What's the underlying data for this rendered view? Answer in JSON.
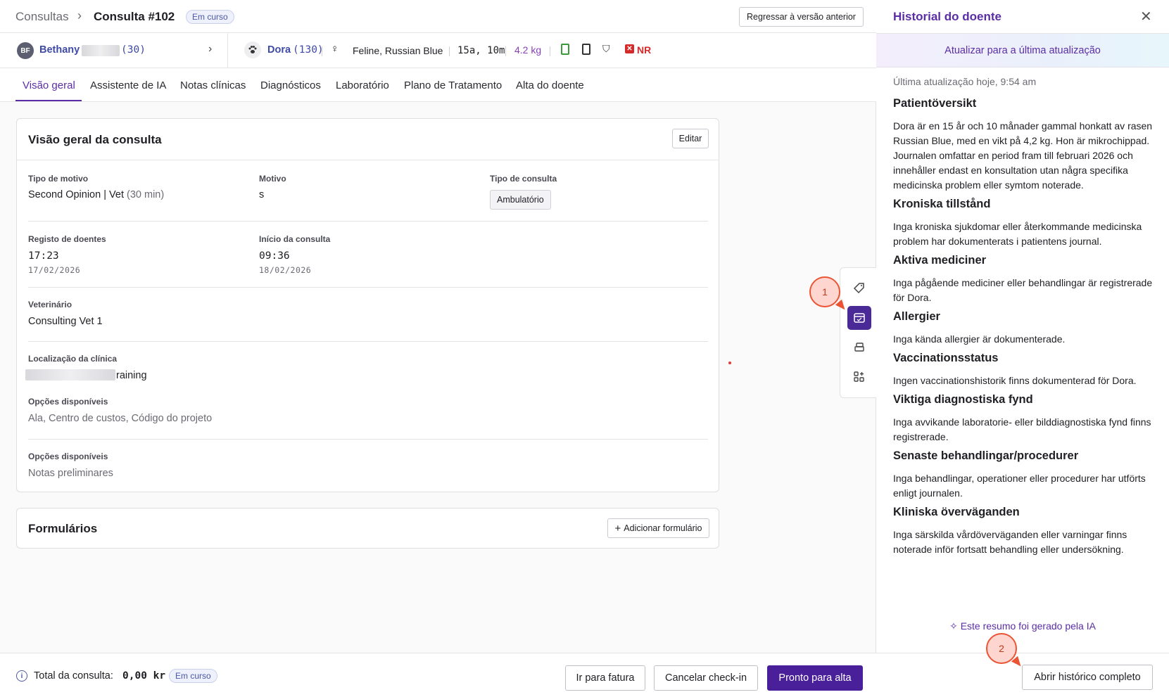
{
  "breadcrumb": {
    "root": "Consultas",
    "separator": "›",
    "current": "Consulta #102"
  },
  "status": "Em curso",
  "revert_button": "Regressar à versão anterior",
  "owner": {
    "initials": "BF",
    "name": "Bethany",
    "count": "(30)"
  },
  "pet": {
    "name": "Dora",
    "count": "(130)",
    "sex_symbol": "♀",
    "breed": "Feline, Russian Blue",
    "age": "15a, 10m",
    "weight": "4.2 kg",
    "flag_letter": "✕",
    "flag": "NR"
  },
  "tabs": [
    "Visão geral",
    "Assistente de IA",
    "Notas clínicas",
    "Diagnósticos",
    "Laboratório",
    "Plano de Tratamento",
    "Alta do doente"
  ],
  "overview": {
    "title": "Visão geral da consulta",
    "edit": "Editar",
    "reason_type_label": "Tipo de motivo",
    "reason_type_value": "Second Opinion | Vet",
    "reason_type_duration": "(30 min)",
    "reason_label": "Motivo",
    "reason_value": "s",
    "consult_type_label": "Tipo de consulta",
    "consult_type_value": "Ambulatório",
    "registry_label": "Registo de doentes",
    "registry_time": "17:23",
    "registry_date": "17/02/2026",
    "start_label": "Início da consulta",
    "start_time": "09:36",
    "start_date": "18/02/2026",
    "vet_label": "Veterinário",
    "vet_value": "Consulting Vet 1",
    "location_label": "Localização da clínica",
    "location_value": "raining",
    "options_label": "Opções disponíveis",
    "options_value": "Ala, Centro de custos, Código do projeto",
    "options2_label": "Opções disponíveis",
    "options2_value": "Notas preliminares"
  },
  "forms": {
    "title": "Formulários",
    "add": "Adicionar formulário"
  },
  "callouts": [
    "1",
    "2"
  ],
  "footer": {
    "info_glyph": "i",
    "total_label": "Total da consulta:",
    "total_value": "0,00 kr",
    "invoice": "Ir para fatura",
    "cancel": "Cancelar check-in",
    "ready": "Pronto para alta"
  },
  "history": {
    "title": "Historial do doente",
    "close": "✕",
    "update_banner": "Atualizar para a última atualização",
    "last_updated": "Última atualização hoje, 9:54 am",
    "sections": [
      {
        "heading": "Patientöversikt",
        "text": "Dora är en 15 år och 10 månader gammal honkatt av rasen Russian Blue, med en vikt på 4,2 kg. Hon är mikrochippad. Journalen omfattar en period fram till februari 2026 och innehåller endast en konsultation utan några specifika medicinska problem eller symtom noterade."
      },
      {
        "heading": "Kroniska tillstånd",
        "text": "Inga kroniska sjukdomar eller återkommande medicinska problem har dokumenterats i patientens journal."
      },
      {
        "heading": "Aktiva mediciner",
        "text": "Inga pågående mediciner eller behandlingar är registrerade för Dora."
      },
      {
        "heading": "Allergier",
        "text": "Inga kända allergier är dokumenterade."
      },
      {
        "heading": "Vaccinationsstatus",
        "text": "Ingen vaccinationshistorik finns dokumenterad för Dora."
      },
      {
        "heading": "Viktiga diagnostiska fynd",
        "text": "Inga avvikande laboratorie- eller bilddiagnostiska fynd finns registrerade."
      },
      {
        "heading": "Senaste behandlingar/procedurer",
        "text": "Inga behandlingar, operationer eller procedurer har utförts enligt journalen."
      },
      {
        "heading": "Kliniska överväganden",
        "text": "Inga särskilda vårdöverväganden eller varningar finns noterade inför fortsatt behandling eller undersökning."
      }
    ],
    "ai_note": "✧ Este resumo foi gerado pela IA",
    "open_full": "Abrir histórico completo"
  },
  "colors": {
    "accent": "#5b2da6",
    "primary_button": "#4a1f9a",
    "link": "#3e4aa8",
    "danger": "#d42a2a",
    "callout": "#ea5434"
  }
}
